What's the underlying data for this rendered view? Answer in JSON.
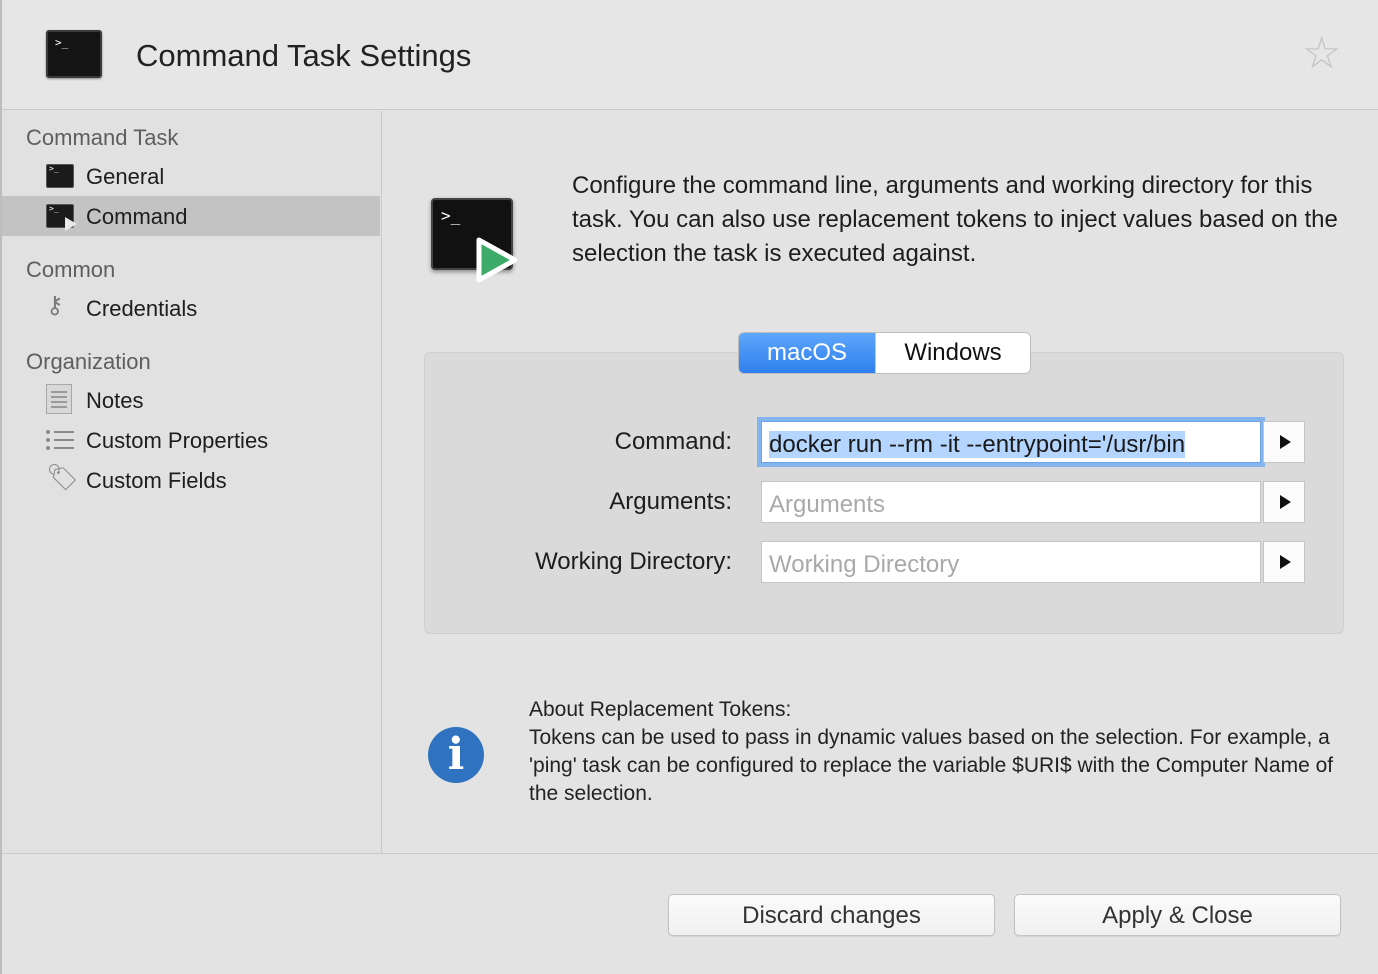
{
  "window": {
    "title": "Command Task Settings"
  },
  "sidebar": {
    "sections": [
      {
        "title": "Command Task",
        "items": [
          {
            "label": "General",
            "icon": "terminal-icon"
          },
          {
            "label": "Command",
            "icon": "terminal-play-icon",
            "selected": true
          }
        ]
      },
      {
        "title": "Common",
        "items": [
          {
            "label": "Credentials",
            "icon": "key-icon"
          }
        ]
      },
      {
        "title": "Organization",
        "items": [
          {
            "label": "Notes",
            "icon": "notes-icon"
          },
          {
            "label": "Custom Properties",
            "icon": "list-icon"
          },
          {
            "label": "Custom Fields",
            "icon": "tag-icon"
          }
        ]
      }
    ]
  },
  "main": {
    "intro": "Configure the command line, arguments and working directory for this task. You can also use replacement tokens to inject values based on the selection the task is executed against.",
    "tabs": [
      {
        "label": "macOS",
        "selected": true
      },
      {
        "label": "Windows",
        "selected": false
      }
    ],
    "form": {
      "command_label": "Command:",
      "command_value": "docker run --rm -it --entrypoint='/usr/bin",
      "arguments_label": "Arguments:",
      "arguments_placeholder": "Arguments",
      "workdir_label": "Working Directory:",
      "workdir_placeholder": "Working Directory"
    },
    "about": {
      "title": "About Replacement Tokens:",
      "body": "Tokens can be used to pass in dynamic values based on the selection. For example, a 'ping' task can be configured to replace the variable $URI$ with the Computer Name of the selection."
    }
  },
  "footer": {
    "discard_label": "Discard changes",
    "apply_label": "Apply & Close"
  },
  "colors": {
    "accent": "#2f80ee",
    "selection": "#c3c3c3",
    "info": "#2e72c0",
    "play": "#3cab6a"
  }
}
